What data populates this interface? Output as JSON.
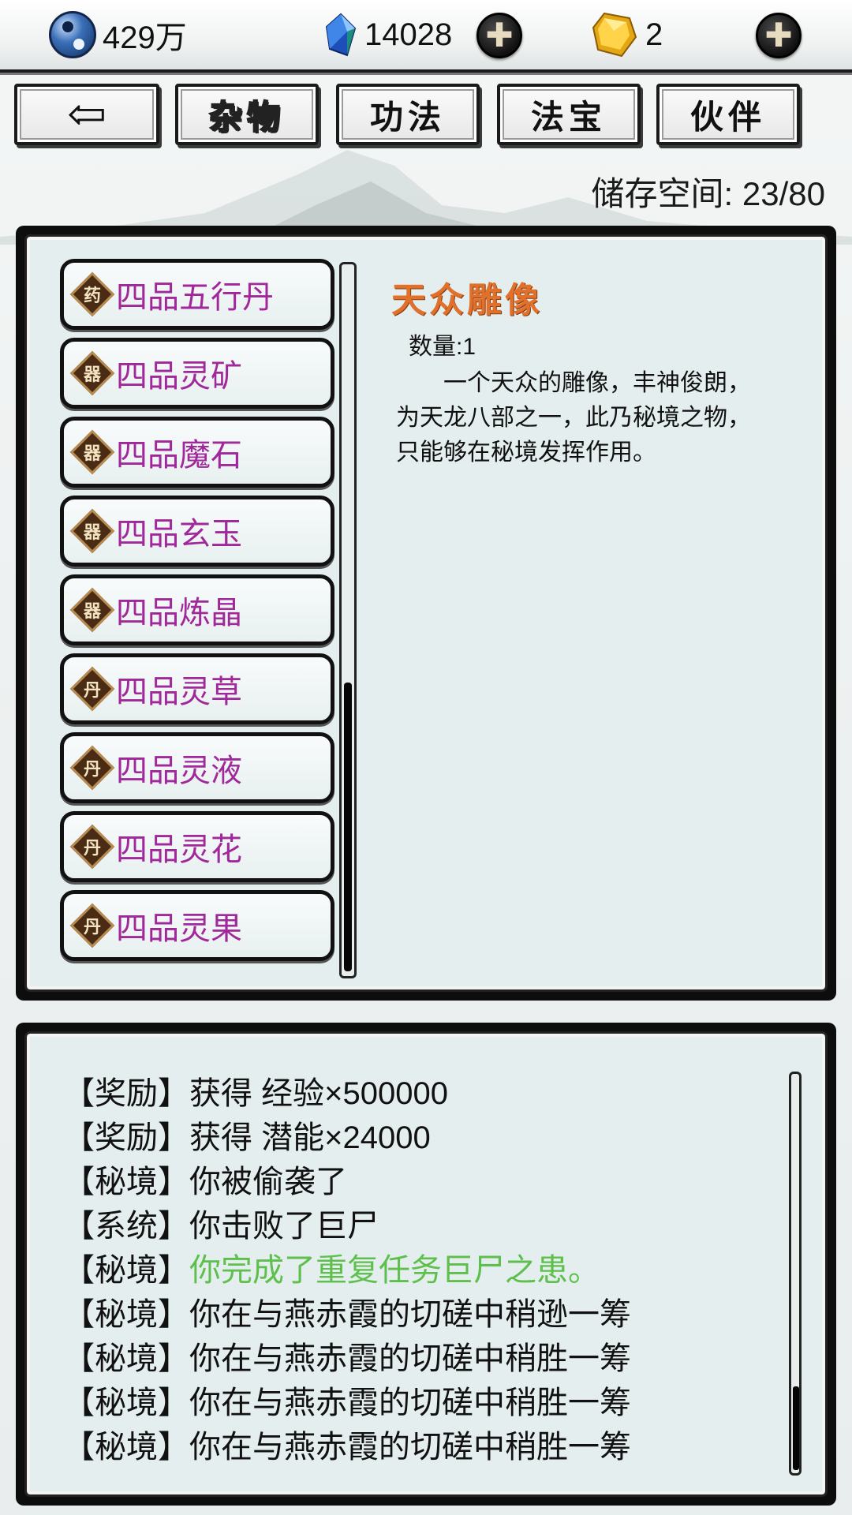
{
  "resources": {
    "spirit": {
      "icon": "taiji-icon",
      "value": "429万"
    },
    "gems": {
      "icon": "blue-crystal-icon",
      "value": "14028"
    },
    "gold": {
      "icon": "gold-gem-icon",
      "value": "2"
    },
    "add_symbol": "✚"
  },
  "tabs": {
    "back_label": "⇦",
    "items": [
      {
        "label": "杂物",
        "active": true
      },
      {
        "label": "功法",
        "active": false
      },
      {
        "label": "法宝",
        "active": false
      },
      {
        "label": "伙伴",
        "active": false
      }
    ]
  },
  "storage": {
    "text": "储存空间: 23/80"
  },
  "items": [
    {
      "glyph": "药",
      "name": "四品五行丹"
    },
    {
      "glyph": "器",
      "name": "四品灵矿"
    },
    {
      "glyph": "器",
      "name": "四品魔石"
    },
    {
      "glyph": "器",
      "name": "四品玄玉"
    },
    {
      "glyph": "器",
      "name": "四品炼晶"
    },
    {
      "glyph": "丹",
      "name": "四品灵草"
    },
    {
      "glyph": "丹",
      "name": "四品灵液"
    },
    {
      "glyph": "丹",
      "name": "四品灵花"
    },
    {
      "glyph": "丹",
      "name": "四品灵果"
    }
  ],
  "detail": {
    "title": "天众雕像",
    "quantity": "数量:1",
    "description": "一个天众的雕像，丰神俊朗，为天龙八部之一，此乃秘境之物，只能够在秘境发挥作用。"
  },
  "log": [
    {
      "tag": "【奖励】",
      "msg": "获得 经验×500000",
      "color": "default"
    },
    {
      "tag": "【奖励】",
      "msg": "获得 潜能×24000",
      "color": "default"
    },
    {
      "tag": "【秘境】",
      "msg": "你被偷袭了",
      "color": "default"
    },
    {
      "tag": "【系统】",
      "msg": "你击败了巨尸",
      "color": "default"
    },
    {
      "tag": "【秘境】",
      "msg": "你完成了重复任务巨尸之患。",
      "color": "green"
    },
    {
      "tag": "【秘境】",
      "msg": "你在与燕赤霞的切磋中稍逊一筹",
      "color": "default"
    },
    {
      "tag": "【秘境】",
      "msg": "你在与燕赤霞的切磋中稍胜一筹",
      "color": "default"
    },
    {
      "tag": "【秘境】",
      "msg": "你在与燕赤霞的切磋中稍胜一筹",
      "color": "default"
    },
    {
      "tag": "【秘境】",
      "msg": "你在与燕赤霞的切磋中稍胜一筹",
      "color": "default"
    }
  ],
  "colors": {
    "item_name": "#a0289a",
    "detail_title": "#e0702a",
    "log_green": "#5fbf4c",
    "active_tab": "#f5e400"
  }
}
